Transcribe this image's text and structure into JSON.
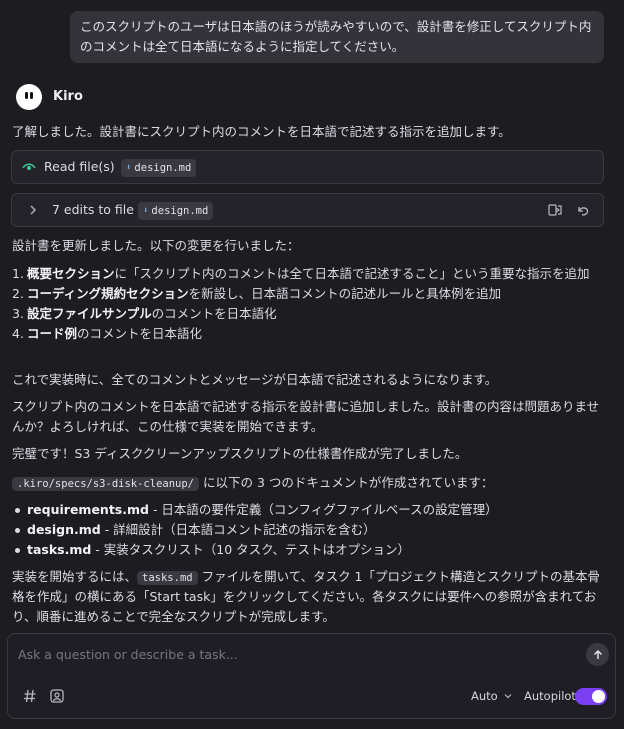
{
  "user_message": "このスクリプトのユーザは日本語のほうが読みやすいので、設計書を修正してスクリプト内のコメントは全て日本語になるように指定してください。",
  "agent": {
    "name": "Kiro"
  },
  "intro": "了解しました。設計書にスクリプト内のコメントを日本語で記述する指示を追加します。",
  "tool_read": {
    "label": "Read file(s)",
    "file": "design.md"
  },
  "tool_edit": {
    "label": "7 edits to file",
    "file": "design.md"
  },
  "update_intro": "設計書を更新しました。以下の変更を行いました：",
  "changes": [
    {
      "num": "1.",
      "bold": "概要セクション",
      "text": "に「スクリプト内のコメントは全て日本語で記述すること」という重要な指示を追加"
    },
    {
      "num": "2.",
      "bold": "コーディング規約セクション",
      "text": "を新設し、日本語コメントの記述ルールと具体例を追加"
    },
    {
      "num": "3.",
      "bold": "設定ファイルサンプル",
      "text": "のコメントを日本語化"
    },
    {
      "num": "4.",
      "bold": "コード例",
      "text": "のコメントを日本語化"
    }
  ],
  "para1": "これで実装時に、全てのコメントとメッセージが日本語で記述されるようになります。",
  "para2": "スクリプト内のコメントを日本語で記述する指示を設計書に追加しました。設計書の内容は問題ありませんか？よろしければ、この仕様で実装を開始できます。",
  "para3": "完璧です！S3 ディスククリーンアップスクリプトの仕様書作成が完了しました。",
  "path_line": {
    "path": ".kiro/specs/s3-disk-cleanup/",
    "text": " に以下の 3 つのドキュメントが作成されています："
  },
  "docs": [
    {
      "bold": "requirements.md",
      "text": " - 日本語の要件定義（コンフィグファイルベースの設定管理）"
    },
    {
      "bold": "design.md",
      "text": " - 詳細設計（日本語コメント記述の指示を含む）"
    },
    {
      "bold": "tasks.md",
      "text": " - 実装タスクリスト（10 タスク、テストはオプション）"
    }
  ],
  "final": {
    "pre": "実装を開始するには、",
    "code": "tasks.md",
    "post": " ファイルを開いて、タスク 1「プロジェクト構造とスクリプトの基本骨格を作成」の横にある「Start task」をクリックしてください。各タスクには要件への参照が含まれており、順番に進めることで完全なスクリプトが完成します。"
  },
  "composer": {
    "placeholder": "Ask a question or describe a task...",
    "mode_label": "Auto",
    "autopilot_label": "Autopilot",
    "autopilot_on": true
  },
  "colors": {
    "accent": "#7b3ff2",
    "background": "#1d1c21"
  }
}
